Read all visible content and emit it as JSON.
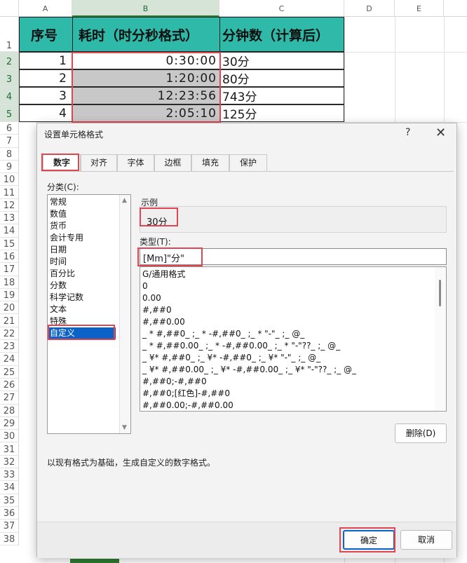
{
  "sheet": {
    "columns": [
      "A",
      "B",
      "C",
      "D",
      "E"
    ],
    "rows": [
      "1",
      "2",
      "3",
      "4",
      "5",
      "6",
      "7",
      "8",
      "9",
      "10",
      "11",
      "12",
      "13",
      "14",
      "15",
      "16",
      "17",
      "18",
      "19",
      "20",
      "21",
      "22",
      "23",
      "24",
      "25",
      "26",
      "27",
      "28",
      "29",
      "30",
      "31",
      "32",
      "33",
      "34",
      "35",
      "36",
      "37",
      "38"
    ],
    "headers": [
      "序号",
      "耗时（时分秒格式）",
      "分钟数（计算后）"
    ],
    "data": [
      {
        "no": "1",
        "time": "0:30:00",
        "minutes": "30分"
      },
      {
        "no": "2",
        "time": "1:20:00",
        "minutes": "80分"
      },
      {
        "no": "3",
        "time": "12:23:56",
        "minutes": "743分"
      },
      {
        "no": "4",
        "time": "2:05:10",
        "minutes": "125分"
      }
    ],
    "colors": {
      "header_bg": "#2fb9a9",
      "highlight": "#e04552",
      "selected_cells": "#c8c8c8"
    }
  },
  "dialog": {
    "title": "设置单元格格式",
    "help": "?",
    "close": "✕",
    "tabs": [
      "数字",
      "对齐",
      "字体",
      "边框",
      "填充",
      "保护"
    ],
    "category_label": "分类(C):",
    "categories": [
      "常规",
      "数值",
      "货币",
      "会计专用",
      "日期",
      "时间",
      "百分比",
      "分数",
      "科学记数",
      "文本",
      "特殊",
      "自定义"
    ],
    "selected_category": "自定义",
    "sample_label": "示例",
    "sample_value": "30分",
    "type_label": "类型(T):",
    "type_value": "[Mm]\"分\"",
    "formats": [
      "G/通用格式",
      "0",
      "0.00",
      "#,##0",
      "#,##0.00",
      "_ * #,##0_ ;_ * -#,##0_ ;_ * \"-\"_ ;_ @_",
      "_ * #,##0.00_ ;_ * -#,##0.00_ ;_ * \"-\"??_ ;_ @_",
      "_ ¥* #,##0_ ;_ ¥* -#,##0_ ;_ ¥* \"-\"_ ;_ @_",
      "_ ¥* #,##0.00_ ;_ ¥* -#,##0.00_ ;_ ¥* \"-\"??_ ;_ @_",
      "#,##0;-#,##0",
      "#,##0;[红色]-#,##0",
      "#,##0.00;-#,##0.00"
    ],
    "delete_button": "删除(D)",
    "description": "以现有格式为基础，生成自定义的数字格式。",
    "ok_button": "确定",
    "cancel_button": "取消"
  }
}
